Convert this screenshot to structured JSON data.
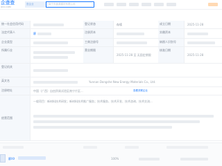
{
  "header": {
    "logo_text": "企查查",
    "logo_sub": "QCC.COM",
    "search_button": "查企业",
    "search_query": "南宁市鑫源建材有限公司"
  },
  "rows": [
    {
      "label": "统一社会信用代码",
      "value": "",
      "label2": "登记状态",
      "value2": "存续",
      "label3": "成立日期",
      "value3": "2025-11-28"
    },
    {
      "label": "法定代表人",
      "value": "廖",
      "label2": "注册资本",
      "value2": "",
      "label3": "实缴资本",
      "value3": ""
    },
    {
      "label": "企业类型",
      "value": "",
      "label2": "工商注册号",
      "value2": "",
      "label3": "纳税人识别号",
      "value3": ""
    },
    {
      "label": "所属行业",
      "value": "",
      "label2": "营业期限",
      "value2": "2025-11-28 至 无固定期限",
      "label3": "核准日期",
      "value3": "2025-11-28"
    },
    {
      "label": "登记机关",
      "value": "",
      "label2": "",
      "value2": "",
      "label3": "",
      "value3": ""
    },
    {
      "label": "英文名",
      "value": "Yunnan Dongshe New Energy Materials Co., Ltd.",
      "label2": "",
      "value2": "",
      "label3": "",
      "value3": ""
    },
    {
      "label": "注册地址",
      "value": "中国（广西）自由贸易试验区南宁片区...",
      "label2": "",
      "value2": "",
      "label3": "",
      "value3": ""
    },
    {
      "label": "经营范围",
      "value": "一般项目：新材料技术研发；新材料技术推广服务；技术服务、技术开发、技术咨询、技术交流...",
      "label2": "",
      "value2": "",
      "label3": "",
      "value3": ""
    }
  ],
  "shareholder": {
    "name": "廖XX",
    "ratio": "100%",
    "amount": ""
  },
  "tags": {
    "related_link": "查看关联企业",
    "history_link": "历史信息"
  }
}
